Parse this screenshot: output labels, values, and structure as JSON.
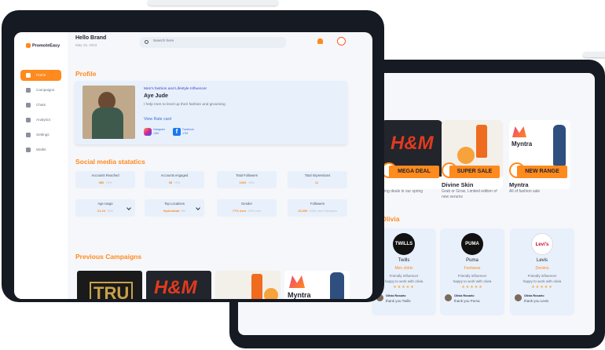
{
  "front": {
    "brand": "PromoteEasy",
    "greeting": "Hello Brand",
    "date": "May 18, 2023",
    "search_placeholder": "Search here",
    "nav": [
      {
        "label": "Home",
        "icon": "home-icon",
        "active": true
      },
      {
        "label": "Campaigns",
        "icon": "campaign-icon"
      },
      {
        "label": "Chats",
        "icon": "chat-icon"
      },
      {
        "label": "Analytics",
        "icon": "analytics-icon"
      },
      {
        "label": "Settings",
        "icon": "gear-icon"
      },
      {
        "label": "Wallet",
        "icon": "wallet-icon"
      }
    ],
    "profile": {
      "section_title": "Profile",
      "tagline": "Men's fashion and Lifestyle Influencer",
      "name": "Aye Jude",
      "bio": "I help men to level up their fashion and grooming",
      "rate_link": "View Rate card",
      "instagram": {
        "label": "Instagram",
        "value": "13M"
      },
      "facebook": {
        "label": "Facebook",
        "value": "17M"
      }
    },
    "stats_title": "Social media statatics",
    "stats": [
      {
        "label": "Accounts Reached",
        "value": "980",
        "trend": "+6%"
      },
      {
        "label": "Accounts engaged",
        "value": "98",
        "trend": "+2%"
      },
      {
        "label": "Total Followers",
        "value": "1620",
        "trend": "+8%"
      },
      {
        "label": "Total Impressions",
        "value": "11",
        "trend": ""
      },
      {
        "label": "Age range",
        "value": "21-24",
        "trend": "75%",
        "dropdown": true
      },
      {
        "label": "Top Locations",
        "value": "Hyderabad",
        "trend": "5%",
        "dropdown": true
      },
      {
        "label": "Gender",
        "value": "77% men",
        "trend": "23% men",
        "dropdown": false
      },
      {
        "label": "Followers",
        "value": "10,000",
        "trend": "1000 new Followers",
        "dropdown": false
      }
    ],
    "campaigns_title": "Previous Campaigns",
    "campaigns": [
      "TRU",
      "H&M",
      "",
      "Myntra"
    ]
  },
  "back": {
    "cards": [
      {
        "name": "",
        "desc": "...ing deals in our spring",
        "badge": "MEGA DEAL",
        "logo": "H&M"
      },
      {
        "name": "Divine Skin",
        "desc": "Grab or Grow, Limited edition of new serums",
        "badge": "SUPER SALE",
        "logo": ""
      },
      {
        "name": "Myntra",
        "desc": "All of fashion sale",
        "badge": "NEW RANGE",
        "logo": "Myntra"
      }
    ],
    "section_title": "...t Olivia",
    "influencers": [
      {
        "logo": "TWILLS",
        "name": "Twills",
        "category": "Men shirts",
        "role": "Friendly influencer",
        "msg": "happy to work with olivia",
        "reviewer": "Olivia Rosario",
        "thanks": "thank you Twills"
      },
      {
        "logo": "PUMA",
        "name": "Puma",
        "category": "Footwear",
        "role": "Friendly influencer",
        "msg": "happy to work with olivia",
        "reviewer": "Olivia Rosario",
        "thanks": "thank you Puma"
      },
      {
        "logo": "Levi's",
        "name": "Levis",
        "category": "Denims",
        "role": "Friendly influencer",
        "msg": "happy to work with olivia",
        "reviewer": "Olivia Rosario",
        "thanks": "thank you Levis"
      }
    ]
  },
  "colors": {
    "accent": "#ff8a1e",
    "card": "#e8f0fb",
    "screen_bg": "#f6f7fa",
    "bezel": "#161a22"
  }
}
